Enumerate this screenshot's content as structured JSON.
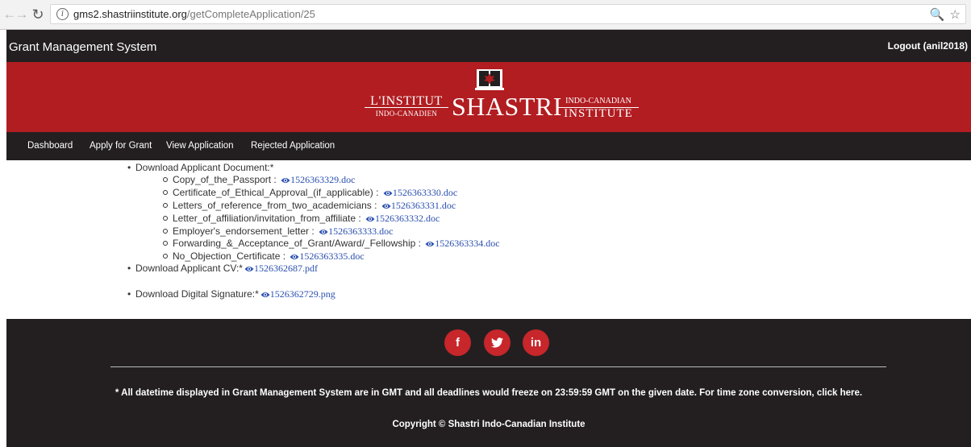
{
  "browser": {
    "url_host": "gms2.shastriinstitute.org",
    "url_path": "/getCompleteApplication/25"
  },
  "header": {
    "title": "Grant Management System",
    "logout_label": "Logout (anil2018)"
  },
  "logo": {
    "left_line1": "L'INSTITUT",
    "left_line2": "INDO-CANADIEN",
    "center": "SHASTRI",
    "right_line1": "INDO-CANADIAN",
    "right_line2": "INSTITUTE"
  },
  "nav": {
    "items": [
      {
        "label": "Dashboard"
      },
      {
        "label": "Apply for Grant"
      },
      {
        "label": "View Application"
      },
      {
        "label": "Rejected Application"
      }
    ]
  },
  "documents": {
    "applicant_doc_label": "Download Applicant Document:*",
    "items": [
      {
        "label": "Copy_of_the_Passport :",
        "file": "1526363329.doc"
      },
      {
        "label": "Certificate_of_Ethical_Approval_(if_applicable) :",
        "file": "1526363330.doc"
      },
      {
        "label": "Letters_of_reference_from_two_academicians :",
        "file": "1526363331.doc"
      },
      {
        "label": "Letter_of_affiliation/invitation_from_affiliate :",
        "file": "1526363332.doc"
      },
      {
        "label": "Employer's_endorsement_letter :",
        "file": "1526363333.doc"
      },
      {
        "label": "Forwarding_&_Acceptance_of_Grant/Award/_Fellowship :",
        "file": "1526363334.doc"
      },
      {
        "label": "No_Objection_Certificate :",
        "file": "1526363335.doc"
      }
    ],
    "cv_label": "Download Applicant CV:*",
    "cv_file": "1526362687.pdf",
    "signature_label": "Download Digital Signature:*",
    "signature_file": "1526362729.png"
  },
  "footer": {
    "social": [
      {
        "icon": "facebook-icon",
        "glyph": "f"
      },
      {
        "icon": "twitter-icon",
        "glyph": "🐦"
      },
      {
        "icon": "linkedin-icon",
        "glyph": "in"
      }
    ],
    "note": "* All datetime displayed in Grant Management System are in GMT and all deadlines would freeze on 23:59:59 GMT on the given date. For time zone conversion, click here.",
    "copyright": "Copyright © Shastri Indo-Canadian Institute"
  },
  "colors": {
    "banner_red": "#b11d21",
    "dark_bar": "#231f20",
    "social_red": "#c7262b",
    "link_blue": "#2a4fb0"
  }
}
